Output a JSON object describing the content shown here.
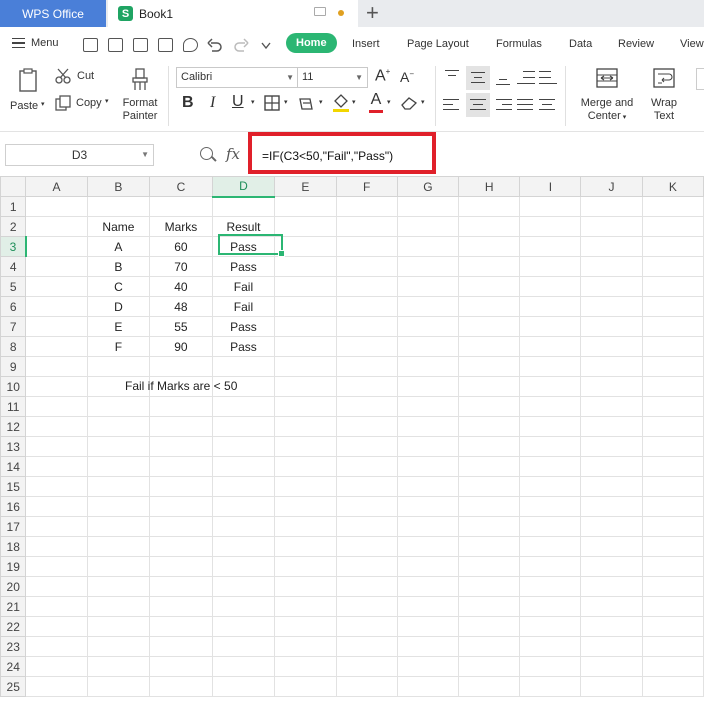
{
  "titlebar": {
    "app_tab": "WPS Office",
    "doc_tab": "Book1",
    "doc_icon_letter": "S",
    "new_tab": "+"
  },
  "menubar": {
    "menu_label": "Menu",
    "tabs": [
      "Home",
      "Insert",
      "Page Layout",
      "Formulas",
      "Data",
      "Review",
      "View"
    ],
    "active_tab": "Home"
  },
  "toolbar": {
    "paste": "Paste",
    "cut": "Cut",
    "copy": "Copy",
    "format_painter_1": "Format",
    "format_painter_2": "Painter",
    "font_name": "Calibri",
    "font_size": "11",
    "bold": "B",
    "italic": "I",
    "underline": "U",
    "font_color_letter": "A",
    "grow_font": "A",
    "shrink_font": "A",
    "merge_center_1": "Merge and",
    "merge_center_2": "Center",
    "wrap_text_1": "Wrap",
    "wrap_text_2": "Text"
  },
  "formula_bar": {
    "name_box": "D3",
    "fx_label": "fx",
    "formula": "=IF(C3<50,\"Fail\",\"Pass\")"
  },
  "sheet": {
    "columns": [
      "A",
      "B",
      "C",
      "D",
      "E",
      "F",
      "G",
      "H",
      "I",
      "J",
      "K"
    ],
    "selected_column": "D",
    "selected_row": "3",
    "rows": [
      {
        "n": "1",
        "cells": [
          "",
          "",
          "",
          ""
        ]
      },
      {
        "n": "2",
        "cells": [
          "",
          "Name",
          "Marks",
          "Result"
        ]
      },
      {
        "n": "3",
        "cells": [
          "",
          "A",
          "60",
          "Pass"
        ]
      },
      {
        "n": "4",
        "cells": [
          "",
          "B",
          "70",
          "Pass"
        ]
      },
      {
        "n": "5",
        "cells": [
          "",
          "C",
          "40",
          "Fail"
        ]
      },
      {
        "n": "6",
        "cells": [
          "",
          "D",
          "48",
          "Fail"
        ]
      },
      {
        "n": "7",
        "cells": [
          "",
          "E",
          "55",
          "Pass"
        ]
      },
      {
        "n": "8",
        "cells": [
          "",
          "F",
          "90",
          "Pass"
        ]
      },
      {
        "n": "9",
        "cells": [
          "",
          "",
          "",
          ""
        ]
      },
      {
        "n": "10",
        "cells": [
          "",
          "",
          "",
          ""
        ]
      },
      {
        "n": "11",
        "cells": [
          "",
          "",
          "",
          ""
        ]
      },
      {
        "n": "12",
        "cells": [
          "",
          "",
          "",
          ""
        ]
      },
      {
        "n": "13",
        "cells": [
          "",
          "",
          "",
          ""
        ]
      },
      {
        "n": "14",
        "cells": [
          "",
          "",
          "",
          ""
        ]
      },
      {
        "n": "15",
        "cells": [
          "",
          "",
          "",
          ""
        ]
      },
      {
        "n": "16",
        "cells": [
          "",
          "",
          "",
          ""
        ]
      },
      {
        "n": "17",
        "cells": [
          "",
          "",
          "",
          ""
        ]
      },
      {
        "n": "18",
        "cells": [
          "",
          "",
          "",
          ""
        ]
      },
      {
        "n": "19",
        "cells": [
          "",
          "",
          "",
          ""
        ]
      },
      {
        "n": "20",
        "cells": [
          "",
          "",
          "",
          ""
        ]
      },
      {
        "n": "21",
        "cells": [
          "",
          "",
          "",
          ""
        ]
      },
      {
        "n": "22",
        "cells": [
          "",
          "",
          "",
          ""
        ]
      },
      {
        "n": "23",
        "cells": [
          "",
          "",
          "",
          ""
        ]
      },
      {
        "n": "24",
        "cells": [
          "",
          "",
          "",
          ""
        ]
      },
      {
        "n": "25",
        "cells": [
          "",
          "",
          "",
          ""
        ]
      }
    ],
    "note": "Fail if Marks are < 50"
  },
  "colors": {
    "accent": "#2bb673",
    "app_tab": "#4a7fd8",
    "highlight_box": "#e0202a"
  }
}
